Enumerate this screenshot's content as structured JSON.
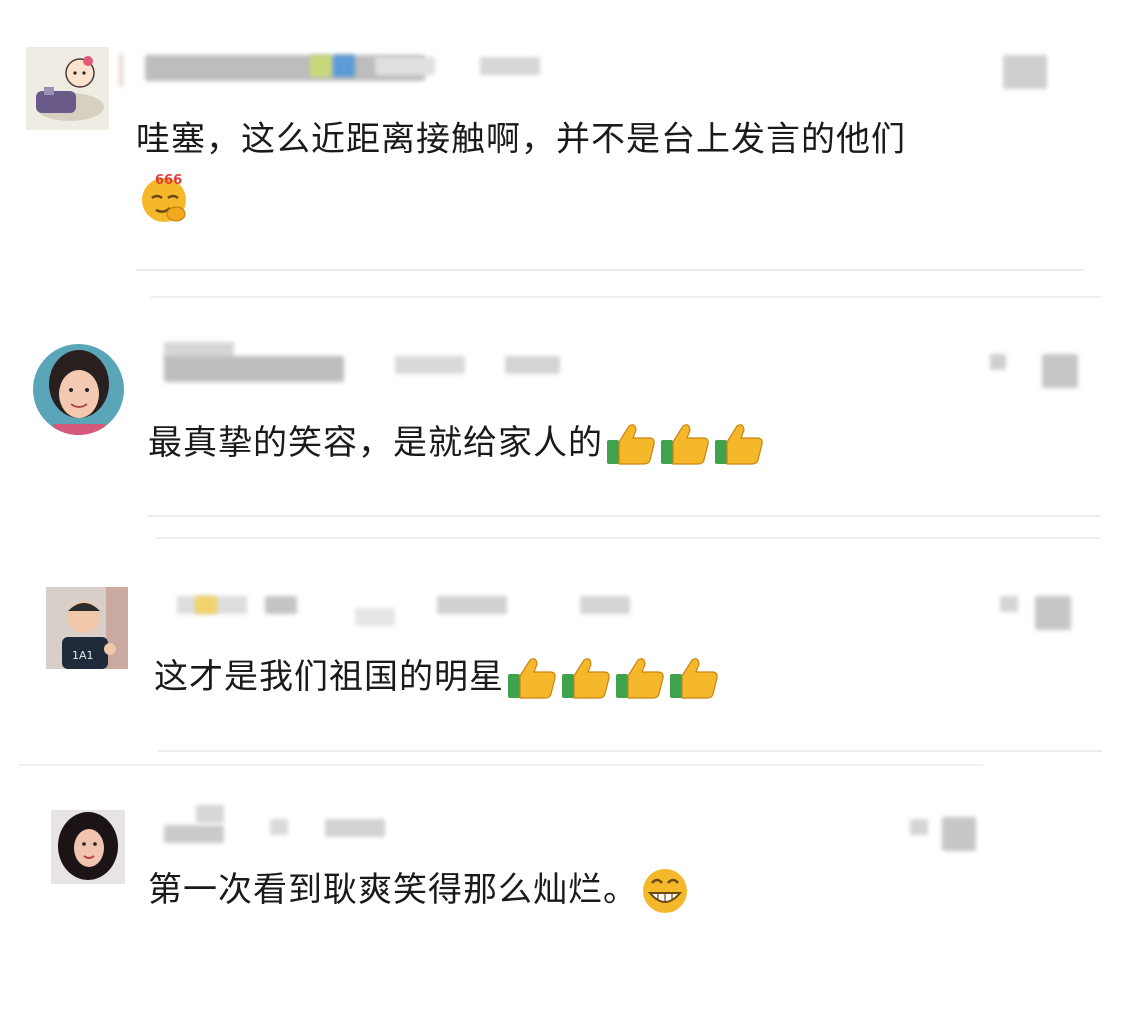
{
  "comments": [
    {
      "text": "哇塞，这么近距离接触啊，并不是台上发言的他们",
      "emoji": "thinking-666",
      "avatar": "cartoon-child-avatar"
    },
    {
      "text": "最真挚的笑容，是就给家人的",
      "emoji": "thumbs-up",
      "emoji_count": 3,
      "avatar": "woman-avatar"
    },
    {
      "text": "这才是我们祖国的明星",
      "emoji": "thumbs-up",
      "emoji_count": 4,
      "avatar": "child-photo-avatar"
    },
    {
      "text": "第一次看到耿爽笑得那么灿烂。",
      "emoji": "grin",
      "avatar": "woman-curly-hair-avatar"
    }
  ],
  "emoji_badge": "666",
  "colors": {
    "divider": "#ececec",
    "text": "#1a1a1a",
    "emoji_yellow": "#f5b82a",
    "thumb_green": "#3fa34d"
  }
}
